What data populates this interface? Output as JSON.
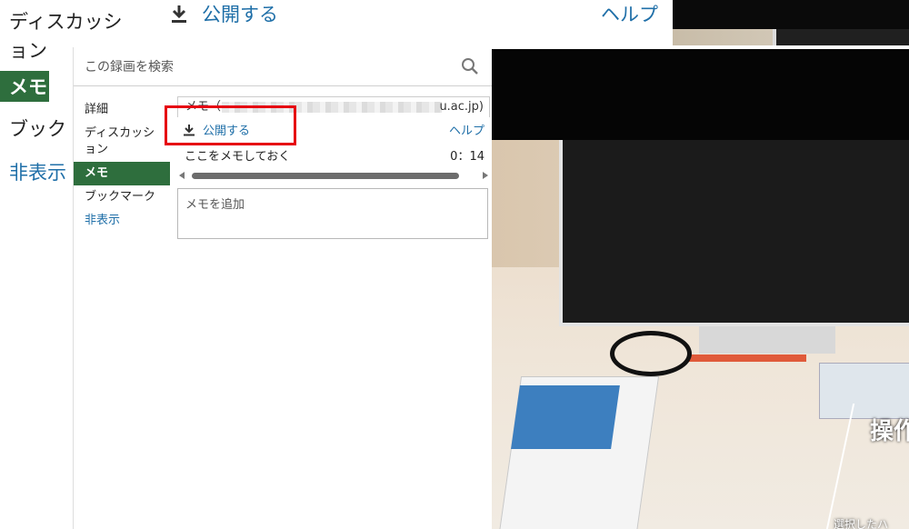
{
  "background": {
    "nav_items": [
      "ディスカッシ",
      "ョン",
      "メモ",
      "ブック",
      "非表示"
    ],
    "publish_label": "公開する",
    "help_label": "ヘルプ"
  },
  "search": {
    "placeholder": "この録画を検索"
  },
  "sidebar": {
    "items": [
      {
        "label": "詳細"
      },
      {
        "label": "ディスカッション"
      },
      {
        "label": "メモ",
        "active": true
      },
      {
        "label": "ブックマーク"
      },
      {
        "label": "非表示"
      }
    ]
  },
  "memo": {
    "owner_prefix": "メモ（",
    "owner_suffix": "u.ac.jp)",
    "publish_label": "公開する",
    "help_label": "ヘルプ",
    "entry_text": "ここをメモしておく",
    "entry_time": "0：14",
    "add_placeholder": "メモを追加"
  },
  "video": {
    "caption_title": "操作",
    "caption_sub": "選択したハ"
  },
  "colors": {
    "accent_green": "#2e6e3d",
    "link_blue": "#1f6fa8",
    "highlight_red": "#e60012"
  }
}
